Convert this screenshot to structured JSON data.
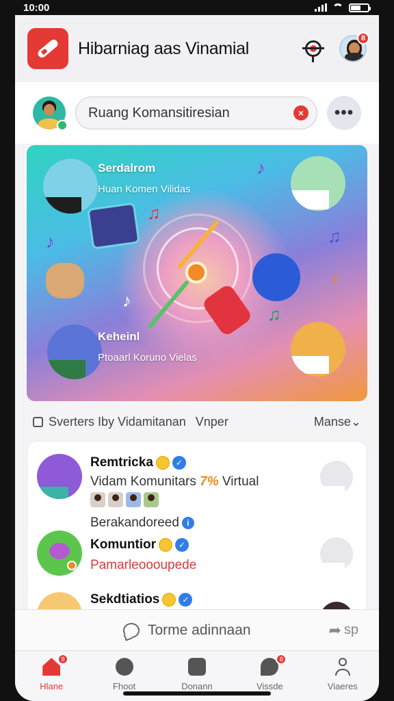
{
  "status_bar": {
    "time": "10:00"
  },
  "header": {
    "title": "Hibarniag aas Vinamial",
    "profile_badge": "8"
  },
  "composer": {
    "placeholder": "Ruang Komansitiresian",
    "more_label": "•••"
  },
  "hero": {
    "top_user": {
      "name": "Serdalrom",
      "subtitle": "Huan Komen Vilidas"
    },
    "bottom_user": {
      "name": "Keheinl",
      "subtitle": "Ptoaarl Koruno Vielas"
    }
  },
  "filter_bar": {
    "label": "Sverters Iby Vidamitanan",
    "tag": "Vnper",
    "sort_label": "Manse⌄"
  },
  "feed": {
    "posts": [
      {
        "name": "Remtricka",
        "text_prefix": "Vidam Komunitars",
        "text_highlight": "7%",
        "text_suffix": "Virtual"
      },
      {
        "section_label": "Berakandoreed",
        "name": "Komuntior",
        "text": "Pamarleoooupede"
      },
      {
        "name": "Sekdtiatios"
      }
    ]
  },
  "comment_bar": {
    "placeholder": "Torme adinnaan",
    "share_label": "sp"
  },
  "tabbar": {
    "tabs": [
      {
        "label": "Hlane",
        "badge": "8"
      },
      {
        "label": "Fhoot"
      },
      {
        "label": "Donann"
      },
      {
        "label": "Vissde",
        "badge": "8"
      },
      {
        "label": "Viaeres"
      }
    ]
  },
  "colors": {
    "accent": "#e53935",
    "verified": "#2f7ee8",
    "highlight": "#f08a1c"
  }
}
